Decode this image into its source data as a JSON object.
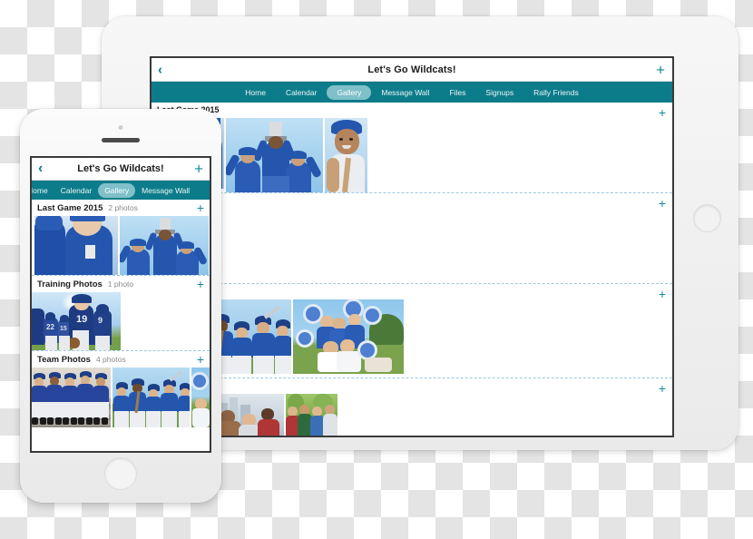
{
  "tablet": {
    "titlebar": {
      "back_icon": "chevron-left-icon",
      "title": "Let's Go Wildcats!",
      "add_icon": "plus-icon"
    },
    "nav": [
      {
        "label": "Home",
        "active": false
      },
      {
        "label": "Calendar",
        "active": false
      },
      {
        "label": "Gallery",
        "active": true
      },
      {
        "label": "Message Wall",
        "active": false
      },
      {
        "label": "Files",
        "active": false
      },
      {
        "label": "Signups",
        "active": false
      },
      {
        "label": "Rally Friends",
        "active": false
      }
    ],
    "rows": [
      {
        "title": "Last Game 2015",
        "add_icon": "plus-icon",
        "photos": 3
      },
      {
        "title": "",
        "add_icon": "plus-icon",
        "photos": 1
      },
      {
        "title": "",
        "add_icon": "plus-icon",
        "photos": 3
      },
      {
        "title": "",
        "add_icon": "plus-icon",
        "photos": 3
      }
    ]
  },
  "phone": {
    "titlebar": {
      "back_icon": "chevron-left-icon",
      "title": "Let's Go Wildcats!",
      "add_icon": "plus-icon"
    },
    "nav": [
      {
        "label": "Home",
        "active": false,
        "clipped": true
      },
      {
        "label": "Calendar",
        "active": false
      },
      {
        "label": "Gallery",
        "active": true
      },
      {
        "label": "Message Wall",
        "active": false
      }
    ],
    "sections": [
      {
        "title": "Last Game 2015",
        "count": "2 photos",
        "add_icon": "plus-icon"
      },
      {
        "title": "Training Photos",
        "count": "1 photo",
        "add_icon": "plus-icon"
      },
      {
        "title": "Team Photos",
        "count": "4 photos",
        "add_icon": "plus-icon"
      }
    ]
  },
  "theme": {
    "teal": "#0d7c8a",
    "teal_light": "#7fc0c9",
    "accent_plus": "#19869a",
    "dash_border": "#9ec6e3",
    "text_dark": "#1c1c1c",
    "text_muted": "#8c8c8c"
  }
}
